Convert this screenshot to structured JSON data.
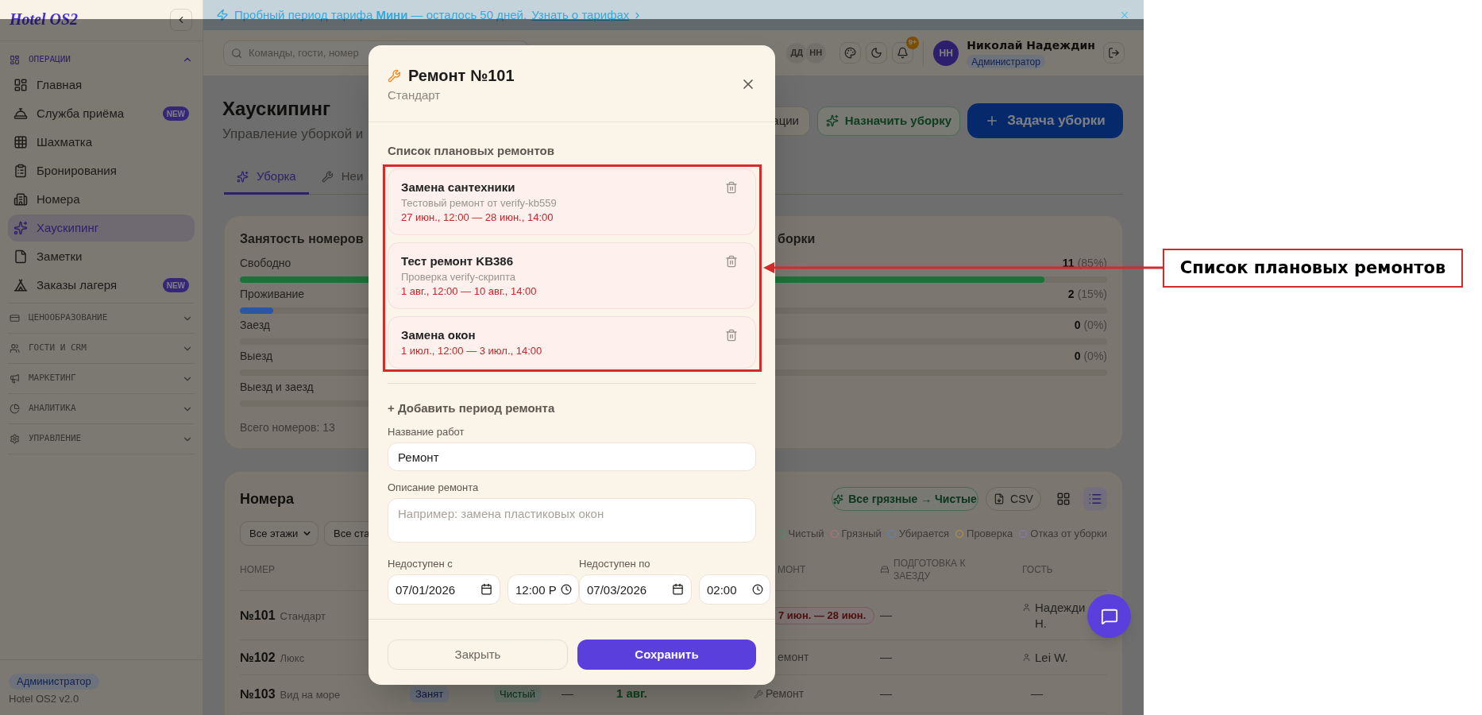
{
  "sidebar": {
    "logo": "Hotel OS2",
    "sections": [
      {
        "label": "ОПЕРАЦИИ",
        "expanded": true,
        "items": [
          {
            "label": "Главная",
            "selected": false
          },
          {
            "label": "Служба приёма",
            "badge": "NEW",
            "selected": false
          },
          {
            "label": "Шахматка",
            "selected": false
          },
          {
            "label": "Бронирования",
            "selected": false
          },
          {
            "label": "Номера",
            "selected": false
          },
          {
            "label": "Хаускипинг",
            "selected": true
          },
          {
            "label": "Заметки",
            "selected": false
          },
          {
            "label": "Заказы лагеря",
            "badge": "NEW",
            "selected": false
          }
        ]
      },
      {
        "label": "ЦЕНООБРАЗОВАНИЕ",
        "expanded": false
      },
      {
        "label": "ГОСТИ И CRM",
        "expanded": false
      },
      {
        "label": "МАРКЕТИНГ",
        "expanded": false
      },
      {
        "label": "АНАЛИТИКА",
        "expanded": false
      },
      {
        "label": "УПРАВЛЕНИЕ",
        "expanded": false
      }
    ],
    "role": "Администратор",
    "version": "Hotel OS2 v2.0"
  },
  "banner": {
    "text": "Пробный период тарифа **Мини** — осталось 50 дней.",
    "link": "Узнать о тарифах"
  },
  "header": {
    "search": {
      "placeholder": "Команды, гости, номер"
    },
    "presence": [
      "ДД",
      "НН"
    ],
    "notifications": "9+",
    "user": {
      "initials": "НН",
      "name": "Николай Надеждин",
      "role": "Администратор"
    }
  },
  "page": {
    "title": "Хаускипинг",
    "subtitle": "Управление уборкой и",
    "actions": [
      {
        "label": "ации",
        "kind": "outline"
      },
      {
        "label": "Назначить уборку",
        "kind": "accent"
      },
      {
        "label": "Задача уборки",
        "kind": "primary"
      }
    ],
    "tabs": [
      {
        "label": "Уборка",
        "selected": true
      },
      {
        "label": "Неи",
        "selected": false
      }
    ]
  },
  "stats": {
    "occupancy": {
      "title": "Занятость номеров",
      "rows": [
        {
          "label": "Свободно",
          "level": 0.92,
          "color": "#1b7339"
        },
        {
          "label": "Проживание",
          "level": 0.08,
          "color": "#2c55a6"
        },
        {
          "label": "Заезд"
        },
        {
          "label": "Выезд"
        },
        {
          "label": "Выезд и заезд"
        }
      ],
      "total": "Всего номеров: 13"
    },
    "panel_2": {
      "title": "борки",
      "rows": [
        {
          "value": "11",
          "percent": "(85%)",
          "level": 0.85,
          "color": "#1b7339"
        },
        {
          "value": "2",
          "percent": "(15%)"
        },
        {
          "value": "0",
          "percent": "(0%)"
        },
        {
          "value": "0",
          "percent": "(0%)"
        }
      ]
    }
  },
  "rooms": {
    "title": "Номера",
    "actions": [
      {
        "label": "Все грязные → Чистые",
        "kind": "accent"
      },
      {
        "label": "CSV",
        "kind": "outline"
      }
    ],
    "views": [
      {
        "selected": false
      },
      {
        "selected": true
      }
    ],
    "filters": [
      {
        "label": "Все этажи"
      },
      {
        "label": "Все ста"
      }
    ],
    "legend": [
      {
        "label": "Чистый",
        "color": "#4a9a6a"
      },
      {
        "label": "Грязный",
        "color": "#c07080"
      },
      {
        "label": "Убирается",
        "color": "#6080c0"
      },
      {
        "label": "Проверка",
        "color": "#b89a30"
      },
      {
        "label": "Отказ от уборки",
        "color": "#8a78c8"
      }
    ],
    "header": {
      "number": "НОМЕР",
      "repair": "МОНТ",
      "prep": "ПОДГОТОВКА К ЗАЕЗДУ",
      "guest": "ГОСТЬ"
    },
    "rows": [
      {
        "number": "№101",
        "type": "Стандарт",
        "repair": {
          "kind": "badge",
          "text": "7 июн. — 28 июн."
        },
        "prep": "—",
        "guest": {
          "kind": "person",
          "name": "Надежди Н."
        }
      },
      {
        "number": "№102",
        "type": "Люкс",
        "repair": {
          "kind": "plain",
          "text": "емонт"
        },
        "prep": "—",
        "guest": {
          "kind": "person",
          "name": "Lei W."
        }
      },
      {
        "number": "№103",
        "type": "Вид на море",
        "status": "Занят",
        "housekeeping": "Чистый",
        "column_4": "—",
        "date": "1 авг.",
        "repair": {
          "kind": "link",
          "text": "Ремонт"
        },
        "prep": "—",
        "guest": {
          "kind": "none",
          "name": "—"
        }
      }
    ]
  },
  "dialog": {
    "title": "Ремонт №101",
    "subtitle": "Стандарт",
    "section": "Список плановых ремонтов",
    "repairs": [
      {
        "title": "Замена сантехники",
        "description": "Тестовый ремонт от verify-kb559",
        "period": "27 июн., 12:00 — 28 июн., 14:00"
      },
      {
        "title": "Тест ремонт KB386",
        "description": "Проверка verify-скрипта",
        "period": "1 авг., 12:00 — 10 авг., 14:00"
      },
      {
        "title": "Замена окон",
        "period": "1 июл., 12:00 — 3 июл., 14:00"
      }
    ],
    "add_label": "+ Добавить период ремонта",
    "name_field": {
      "label": "Название работ",
      "value": "Ремонт"
    },
    "description_field": {
      "label": "Описание ремонта",
      "placeholder": "Например: замена пластиковых окон"
    },
    "periods": [
      {
        "label": "Недоступен с",
        "date": "07/01/2026",
        "time": "12:00 P"
      },
      {
        "label": "Недоступен по",
        "date": "07/03/2026",
        "time": "02:00"
      }
    ],
    "buttons": [
      {
        "label": "Закрыть",
        "kind": "secondary"
      },
      {
        "label": "Сохранить",
        "kind": "primary"
      }
    ]
  },
  "annotation": {
    "label": "Список плановых ремонтов"
  }
}
